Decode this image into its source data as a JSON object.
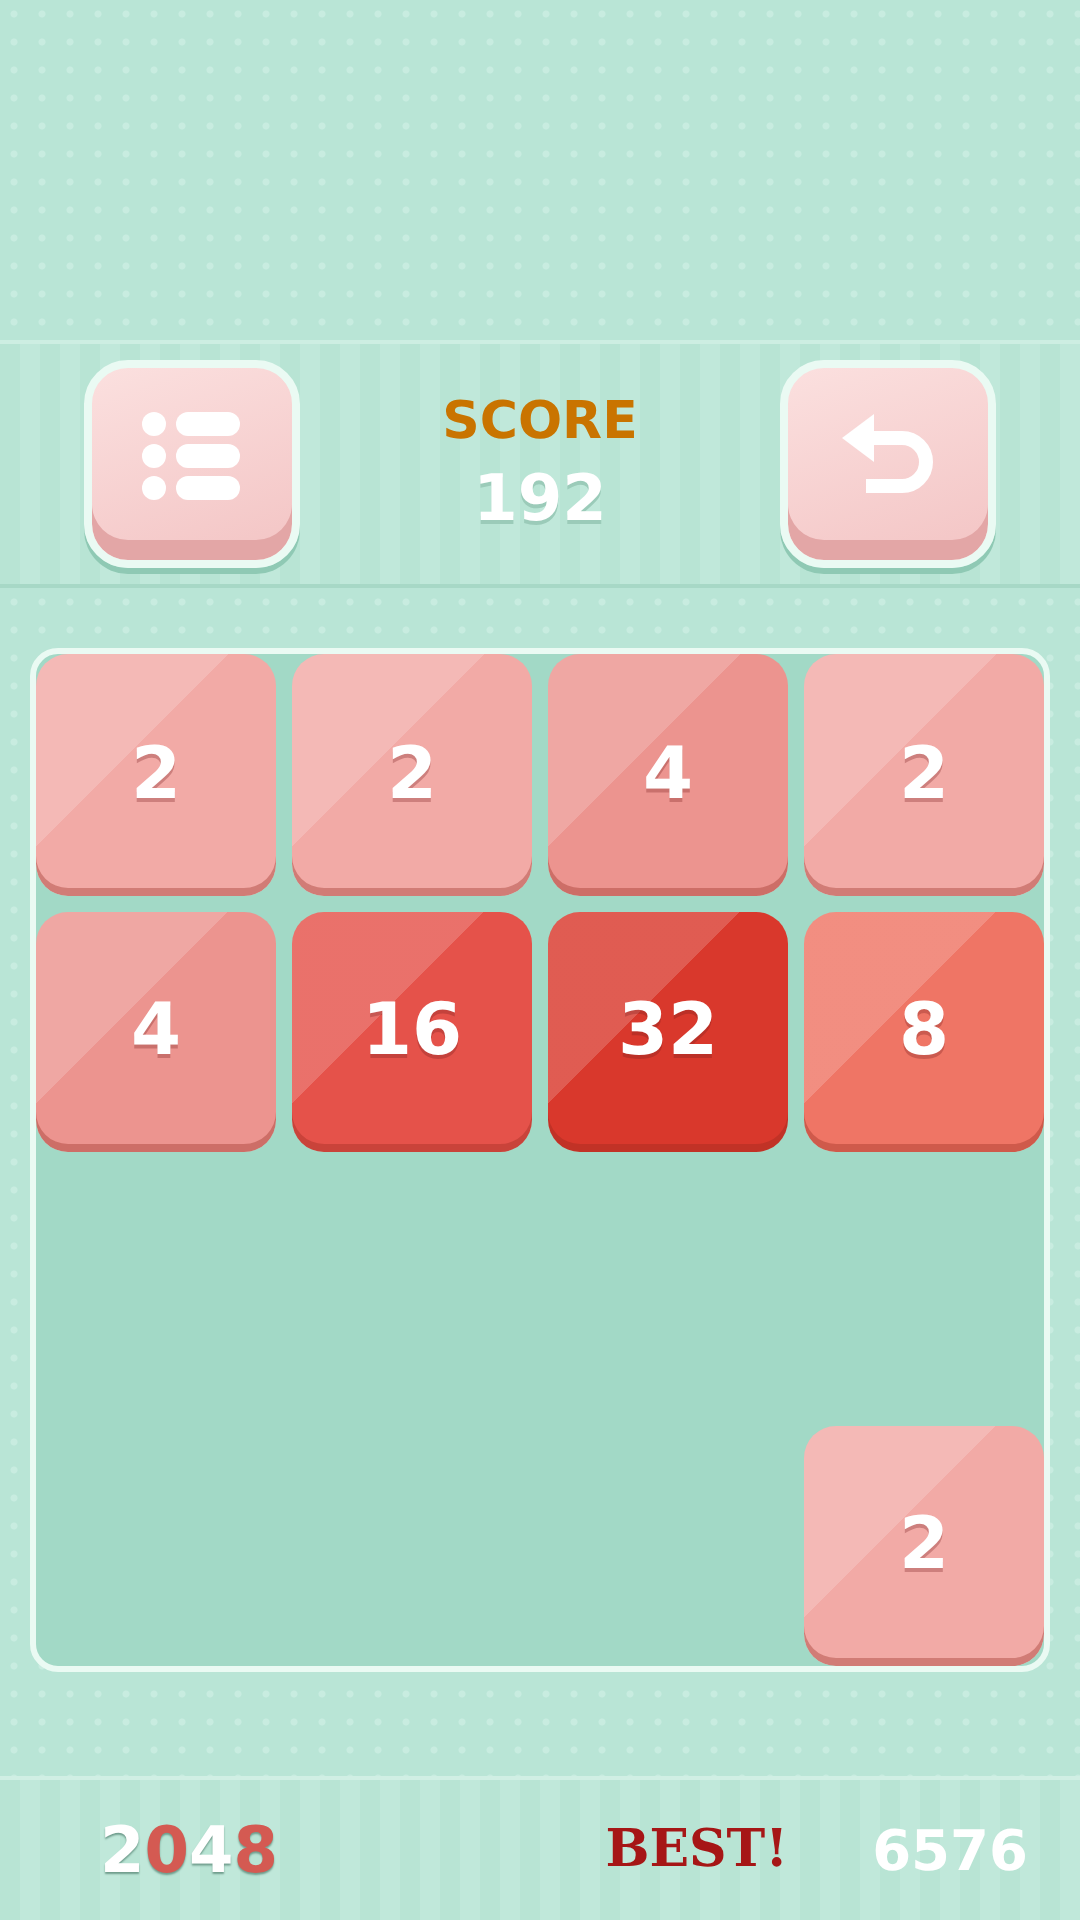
{
  "header": {
    "score_label": "SCORE",
    "score": "192"
  },
  "board": {
    "rows": [
      {
        "cells": [
          {
            "kind": "tile",
            "value": "2",
            "color": "#f2aaa6"
          },
          {
            "kind": "tile",
            "value": "2",
            "color": "#f2aaa6"
          },
          {
            "kind": "tile",
            "value": "4",
            "color": "#ec948f"
          },
          {
            "kind": "tile",
            "value": "2",
            "color": "#f2aaa6"
          }
        ]
      },
      {
        "cells": [
          {
            "kind": "tile",
            "value": "4",
            "color": "#ec948f"
          },
          {
            "kind": "tile",
            "value": "16",
            "color": "#e5524a"
          },
          {
            "kind": "tile",
            "value": "32",
            "color": "#d9382c"
          },
          {
            "kind": "tile",
            "value": "8",
            "color": "#ef7565"
          }
        ]
      },
      {
        "cells": [
          {
            "kind": "empty"
          },
          {
            "kind": "empty"
          },
          {
            "kind": "empty"
          },
          {
            "kind": "empty"
          }
        ]
      },
      {
        "cells": [
          {
            "kind": "empty"
          },
          {
            "kind": "empty"
          },
          {
            "kind": "empty"
          },
          {
            "kind": "tile",
            "value": "2",
            "color": "#f2aaa6"
          }
        ]
      }
    ]
  },
  "footer": {
    "logo": [
      {
        "char": "2",
        "color": "#ffffff"
      },
      {
        "char": "0",
        "color": "#d45a52"
      },
      {
        "char": "4",
        "color": "#ffffff"
      },
      {
        "char": "8",
        "color": "#d45a52"
      }
    ],
    "best_label": "BEST!",
    "best": "6576"
  }
}
